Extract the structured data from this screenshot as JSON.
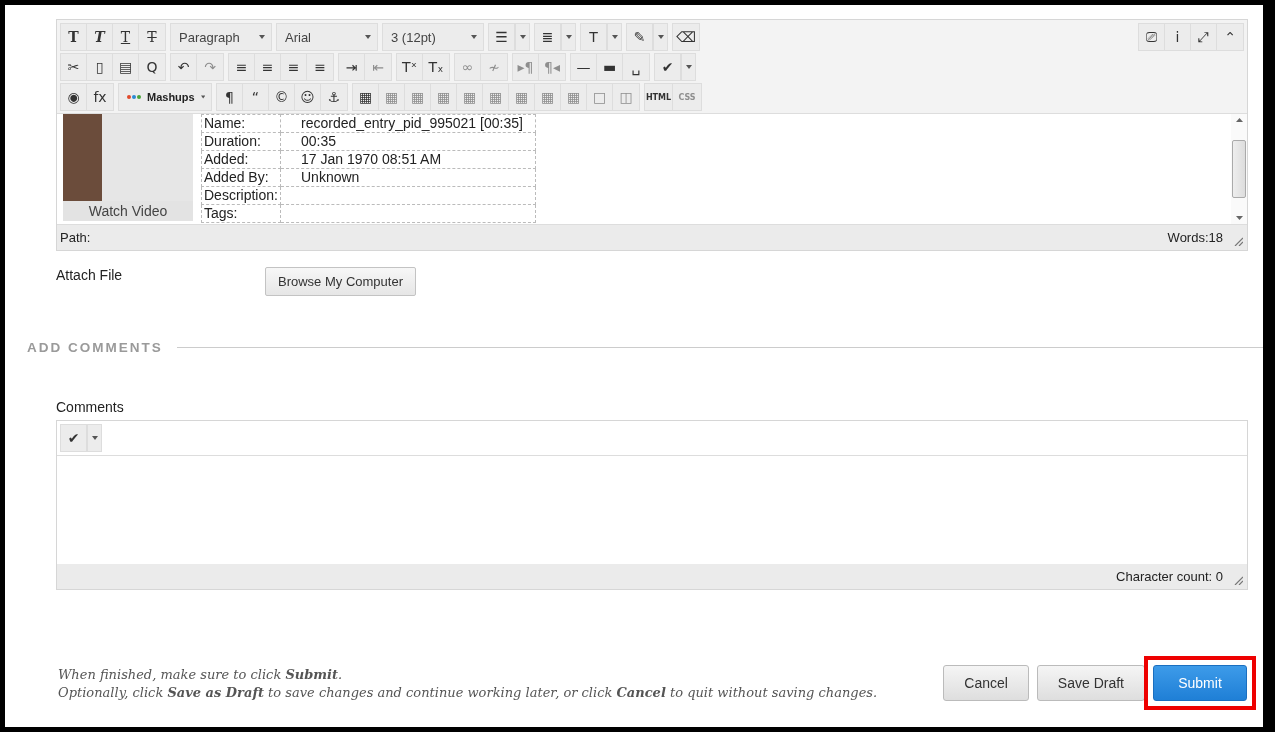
{
  "editor": {
    "toolbar": {
      "rows": [
        {
          "groups": [
            {
              "items": [
                {
                  "kind": "icon",
                  "glyph": "T",
                  "disabled": false
                },
                {
                  "kind": "icon",
                  "glyph": "T",
                  "disabled": false
                },
                {
                  "kind": "icon",
                  "glyph": "T",
                  "disabled": false
                },
                {
                  "kind": "icon",
                  "glyph": "T",
                  "disabled": false
                }
              ]
            },
            {
              "items": [
                {
                  "kind": "select",
                  "label": "Paragraph"
                }
              ]
            },
            {
              "items": [
                {
                  "kind": "select",
                  "label": "Arial"
                }
              ]
            },
            {
              "items": [
                {
                  "kind": "select",
                  "label": "3 (12pt)"
                }
              ]
            },
            {
              "items": [
                {
                  "kind": "split",
                  "glyph": "☰",
                  "disabled": false
                }
              ]
            },
            {
              "items": [
                {
                  "kind": "split",
                  "glyph": "≣",
                  "disabled": false
                }
              ]
            },
            {
              "items": [
                {
                  "kind": "split",
                  "glyph": "T",
                  "disabled": false
                }
              ]
            },
            {
              "items": [
                {
                  "kind": "split",
                  "glyph": "✎",
                  "disabled": false
                }
              ]
            },
            {
              "items": [
                {
                  "kind": "icon",
                  "glyph": "⌫",
                  "disabled": false
                }
              ]
            }
          ]
        },
        {
          "groups": [
            {
              "items": [
                {
                  "kind": "icon",
                  "glyph": "✂",
                  "disabled": false
                },
                {
                  "kind": "icon",
                  "glyph": "▯",
                  "disabled": false
                },
                {
                  "kind": "icon",
                  "glyph": "▤",
                  "disabled": false
                },
                {
                  "kind": "icon",
                  "glyph": "Q",
                  "disabled": false
                }
              ]
            },
            {
              "items": [
                {
                  "kind": "icon",
                  "glyph": "↶",
                  "disabled": false
                },
                {
                  "kind": "icon",
                  "glyph": "↷",
                  "disabled": true
                }
              ]
            },
            {
              "items": [
                {
                  "kind": "icon",
                  "glyph": "≡",
                  "disabled": false
                },
                {
                  "kind": "icon",
                  "glyph": "≡",
                  "disabled": false
                },
                {
                  "kind": "icon",
                  "glyph": "≡",
                  "disabled": false
                },
                {
                  "kind": "icon",
                  "glyph": "≡",
                  "disabled": false
                }
              ]
            },
            {
              "items": [
                {
                  "kind": "icon",
                  "glyph": "⇥",
                  "disabled": false
                },
                {
                  "kind": "icon",
                  "glyph": "⇤",
                  "disabled": true
                }
              ]
            },
            {
              "items": [
                {
                  "kind": "icon",
                  "glyph": "Tˣ",
                  "disabled": false
                },
                {
                  "kind": "icon",
                  "glyph": "Tₓ",
                  "disabled": false
                }
              ]
            },
            {
              "items": [
                {
                  "kind": "icon",
                  "glyph": "∞",
                  "disabled": true
                },
                {
                  "kind": "icon",
                  "glyph": "≁",
                  "disabled": true
                }
              ]
            },
            {
              "items": [
                {
                  "kind": "icon",
                  "glyph": "▸¶",
                  "disabled": true
                },
                {
                  "kind": "icon",
                  "glyph": "¶◂",
                  "disabled": true
                }
              ]
            },
            {
              "items": [
                {
                  "kind": "icon",
                  "glyph": "—",
                  "disabled": false
                },
                {
                  "kind": "icon",
                  "glyph": "▬",
                  "disabled": false
                },
                {
                  "kind": "icon",
                  "glyph": "␣",
                  "disabled": false
                }
              ]
            },
            {
              "items": [
                {
                  "kind": "split",
                  "glyph": "✔",
                  "disabled": false
                }
              ]
            }
          ]
        },
        {
          "groups": [
            {
              "items": [
                {
                  "kind": "icon",
                  "glyph": "◉",
                  "disabled": false
                },
                {
                  "kind": "icon",
                  "glyph": "fx",
                  "disabled": false
                }
              ]
            },
            {
              "items": [
                {
                  "kind": "select",
                  "label": "Mashups"
                }
              ]
            },
            {
              "items": [
                {
                  "kind": "icon",
                  "glyph": "¶",
                  "disabled": false
                },
                {
                  "kind": "icon",
                  "glyph": "“",
                  "disabled": false
                },
                {
                  "kind": "icon",
                  "glyph": "©",
                  "disabled": false
                },
                {
                  "kind": "icon",
                  "glyph": "☺",
                  "disabled": false
                },
                {
                  "kind": "icon",
                  "glyph": "⚓",
                  "disabled": false
                }
              ]
            },
            {
              "items": [
                {
                  "kind": "icon",
                  "glyph": "▦",
                  "disabled": false
                },
                {
                  "kind": "icon",
                  "glyph": "▦",
                  "disabled": true
                },
                {
                  "kind": "icon",
                  "glyph": "▦",
                  "disabled": true
                },
                {
                  "kind": "icon",
                  "glyph": "▦",
                  "disabled": true
                },
                {
                  "kind": "icon",
                  "glyph": "▦",
                  "disabled": true
                },
                {
                  "kind": "icon",
                  "glyph": "▦",
                  "disabled": true
                },
                {
                  "kind": "icon",
                  "glyph": "▦",
                  "disabled": true
                },
                {
                  "kind": "icon",
                  "glyph": "▦",
                  "disabled": true
                },
                {
                  "kind": "icon",
                  "glyph": "▦",
                  "disabled": true
                },
                {
                  "kind": "icon",
                  "glyph": "□",
                  "disabled": true
                },
                {
                  "kind": "icon",
                  "glyph": "◫",
                  "disabled": true
                }
              ]
            },
            {
              "items": [
                {
                  "kind": "text",
                  "glyph": "HTML",
                  "disabled": false
                },
                {
                  "kind": "text",
                  "glyph": "CSS",
                  "disabled": true
                }
              ]
            }
          ]
        }
      ],
      "right": [
        {
          "glyph": "⎚",
          "disabled": false
        },
        {
          "glyph": "i",
          "disabled": false
        },
        {
          "glyph": "⤢",
          "disabled": false
        },
        {
          "glyph": "⌃",
          "disabled": false
        }
      ]
    },
    "media": {
      "caption": "Watch Video",
      "rows": [
        {
          "label": "Name:",
          "value": "recorded_entry_pid_995021 [00:35]"
        },
        {
          "label": "Duration:",
          "value": "00:35"
        },
        {
          "label": "Added:",
          "value": "17 Jan 1970 08:51 AM"
        },
        {
          "label": "Added By:",
          "value": "Unknown"
        },
        {
          "label": "Description:",
          "value": ""
        },
        {
          "label": "Tags:",
          "value": ""
        }
      ]
    },
    "path_label": "Path:",
    "word_count": "Words:18"
  },
  "attach": {
    "label": "Attach File",
    "button": "Browse My Computer"
  },
  "section_title": "ADD COMMENTS",
  "comments": {
    "label": "Comments",
    "toolbar": [
      {
        "kind": "split",
        "glyph": "✔",
        "disabled": false
      }
    ],
    "char_count": "Character count: 0"
  },
  "instructions": [
    "When finished, make sure to click **Submit**.",
    "Optionally, click **Save as Draft** to save changes and continue working later, or click **Cancel** to quit without saving changes."
  ],
  "buttons": [
    {
      "label": "Cancel",
      "kind": "default",
      "highlighted": false
    },
    {
      "label": "Save Draft",
      "kind": "default",
      "highlighted": false
    },
    {
      "label": "Submit",
      "kind": "primary",
      "highlighted": true
    }
  ]
}
